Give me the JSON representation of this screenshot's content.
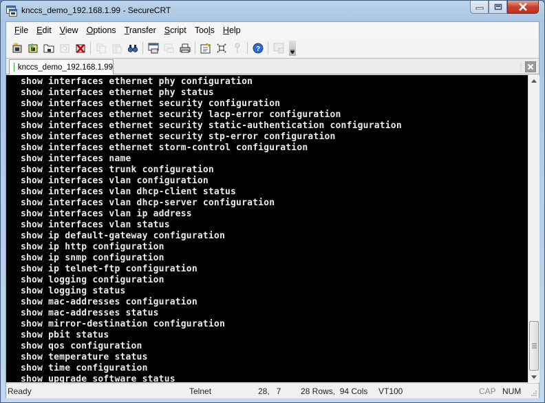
{
  "window": {
    "title": "knccs_demo_192.168.1.99 - SecureCRT",
    "icon": "securecrt-app-icon",
    "caption_buttons": [
      "minimize",
      "maximize",
      "close"
    ]
  },
  "menubar": {
    "items": [
      {
        "label": "File",
        "accel": "F",
        "rest": "ile"
      },
      {
        "label": "Edit",
        "accel": "E",
        "rest": "dit"
      },
      {
        "label": "View",
        "accel": "V",
        "rest": "iew"
      },
      {
        "label": "Options",
        "accel": "O",
        "rest": "ptions"
      },
      {
        "label": "Transfer",
        "accel": "T",
        "rest": "ransfer"
      },
      {
        "label": "Script",
        "accel": "S",
        "rest": "cript"
      },
      {
        "label": "Tools",
        "pre": "Too",
        "accel": "l",
        "rest": "s"
      },
      {
        "label": "Help",
        "accel": "H",
        "rest": "elp"
      }
    ]
  },
  "toolbar": {
    "buttons": [
      {
        "name": "connect",
        "icon": "connect-icon"
      },
      {
        "name": "quick-connect",
        "icon": "quick-connect-icon"
      },
      {
        "name": "connect-in-tab",
        "icon": "connect-tab-icon"
      },
      {
        "name": "reconnect",
        "icon": "reconnect-icon",
        "disabled": true
      },
      {
        "name": "disconnect",
        "icon": "disconnect-icon"
      },
      {
        "sep": true
      },
      {
        "name": "copy",
        "icon": "copy-icon",
        "disabled": true
      },
      {
        "name": "paste",
        "icon": "paste-icon",
        "disabled": true
      },
      {
        "name": "find",
        "icon": "find-icon"
      },
      {
        "sep": true
      },
      {
        "name": "print-screen",
        "icon": "print-screen-icon"
      },
      {
        "name": "print-selection",
        "icon": "print-selection-icon",
        "disabled": true
      },
      {
        "name": "print",
        "icon": "print-icon"
      },
      {
        "sep": true
      },
      {
        "name": "session-options",
        "icon": "session-options-icon"
      },
      {
        "name": "global-options",
        "icon": "global-options-icon"
      },
      {
        "name": "keymap",
        "icon": "key-icon",
        "disabled": true
      },
      {
        "sep": true
      },
      {
        "name": "help",
        "icon": "help-icon"
      },
      {
        "sep": true
      },
      {
        "name": "sftp",
        "icon": "sftp-icon",
        "disabled": true
      }
    ]
  },
  "tabs": [
    {
      "label": "knccs_demo_192.168.1.99",
      "status": "connected",
      "status_color": "#2fae2f"
    }
  ],
  "terminal": {
    "lines": [
      "show interfaces ethernet phy configuration",
      "show interfaces ethernet phy status",
      "show interfaces ethernet security configuration",
      "show interfaces ethernet security lacp-error configuration",
      "show interfaces ethernet security static-authentication configuration",
      "show interfaces ethernet security stp-error configuration",
      "show interfaces ethernet storm-control configuration",
      "show interfaces name",
      "show interfaces trunk configuration",
      "show interfaces vlan configuration",
      "show interfaces vlan dhcp-client status",
      "show interfaces vlan dhcp-server configuration",
      "show interfaces vlan ip address",
      "show interfaces vlan status",
      "show ip default-gateway configuration",
      "show ip http configuration",
      "show ip snmp configuration",
      "show ip telnet-ftp configuration",
      "show logging configuration",
      "show logging status",
      "show mac-addresses configuration",
      "show mac-addresses status",
      "show mirror-destination configuration",
      "show pbit status",
      "show qos configuration",
      "show temperature status",
      "show time configuration",
      "show upgrade software status"
    ],
    "scroll_position": 0.95
  },
  "statusbar": {
    "state": "Ready",
    "protocol": "Telnet",
    "cursor": "28,   7",
    "size": "28 Rows,  94 Cols",
    "emulation": "VT100",
    "cap": "CAP",
    "num": "NUM"
  }
}
